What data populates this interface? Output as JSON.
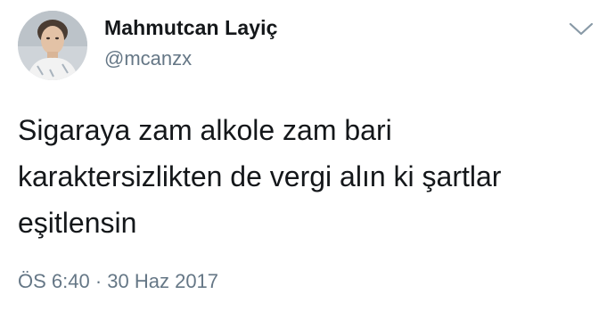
{
  "author": {
    "display_name": "Mahmutcan Layiç",
    "username": "@mcanzx",
    "avatar_icon": "profile-photo"
  },
  "menu": {
    "icon": "chevron-down-icon"
  },
  "tweet": {
    "text": "Sigaraya zam alkole zam bari\nkaraktersizlikten de vergi alın ki şartlar\neşitlensin",
    "timestamp": "ÖS 6:40 · 30 Haz 2017"
  },
  "colors": {
    "text_primary": "#14171a",
    "text_secondary": "#657786",
    "background": "#ffffff"
  }
}
